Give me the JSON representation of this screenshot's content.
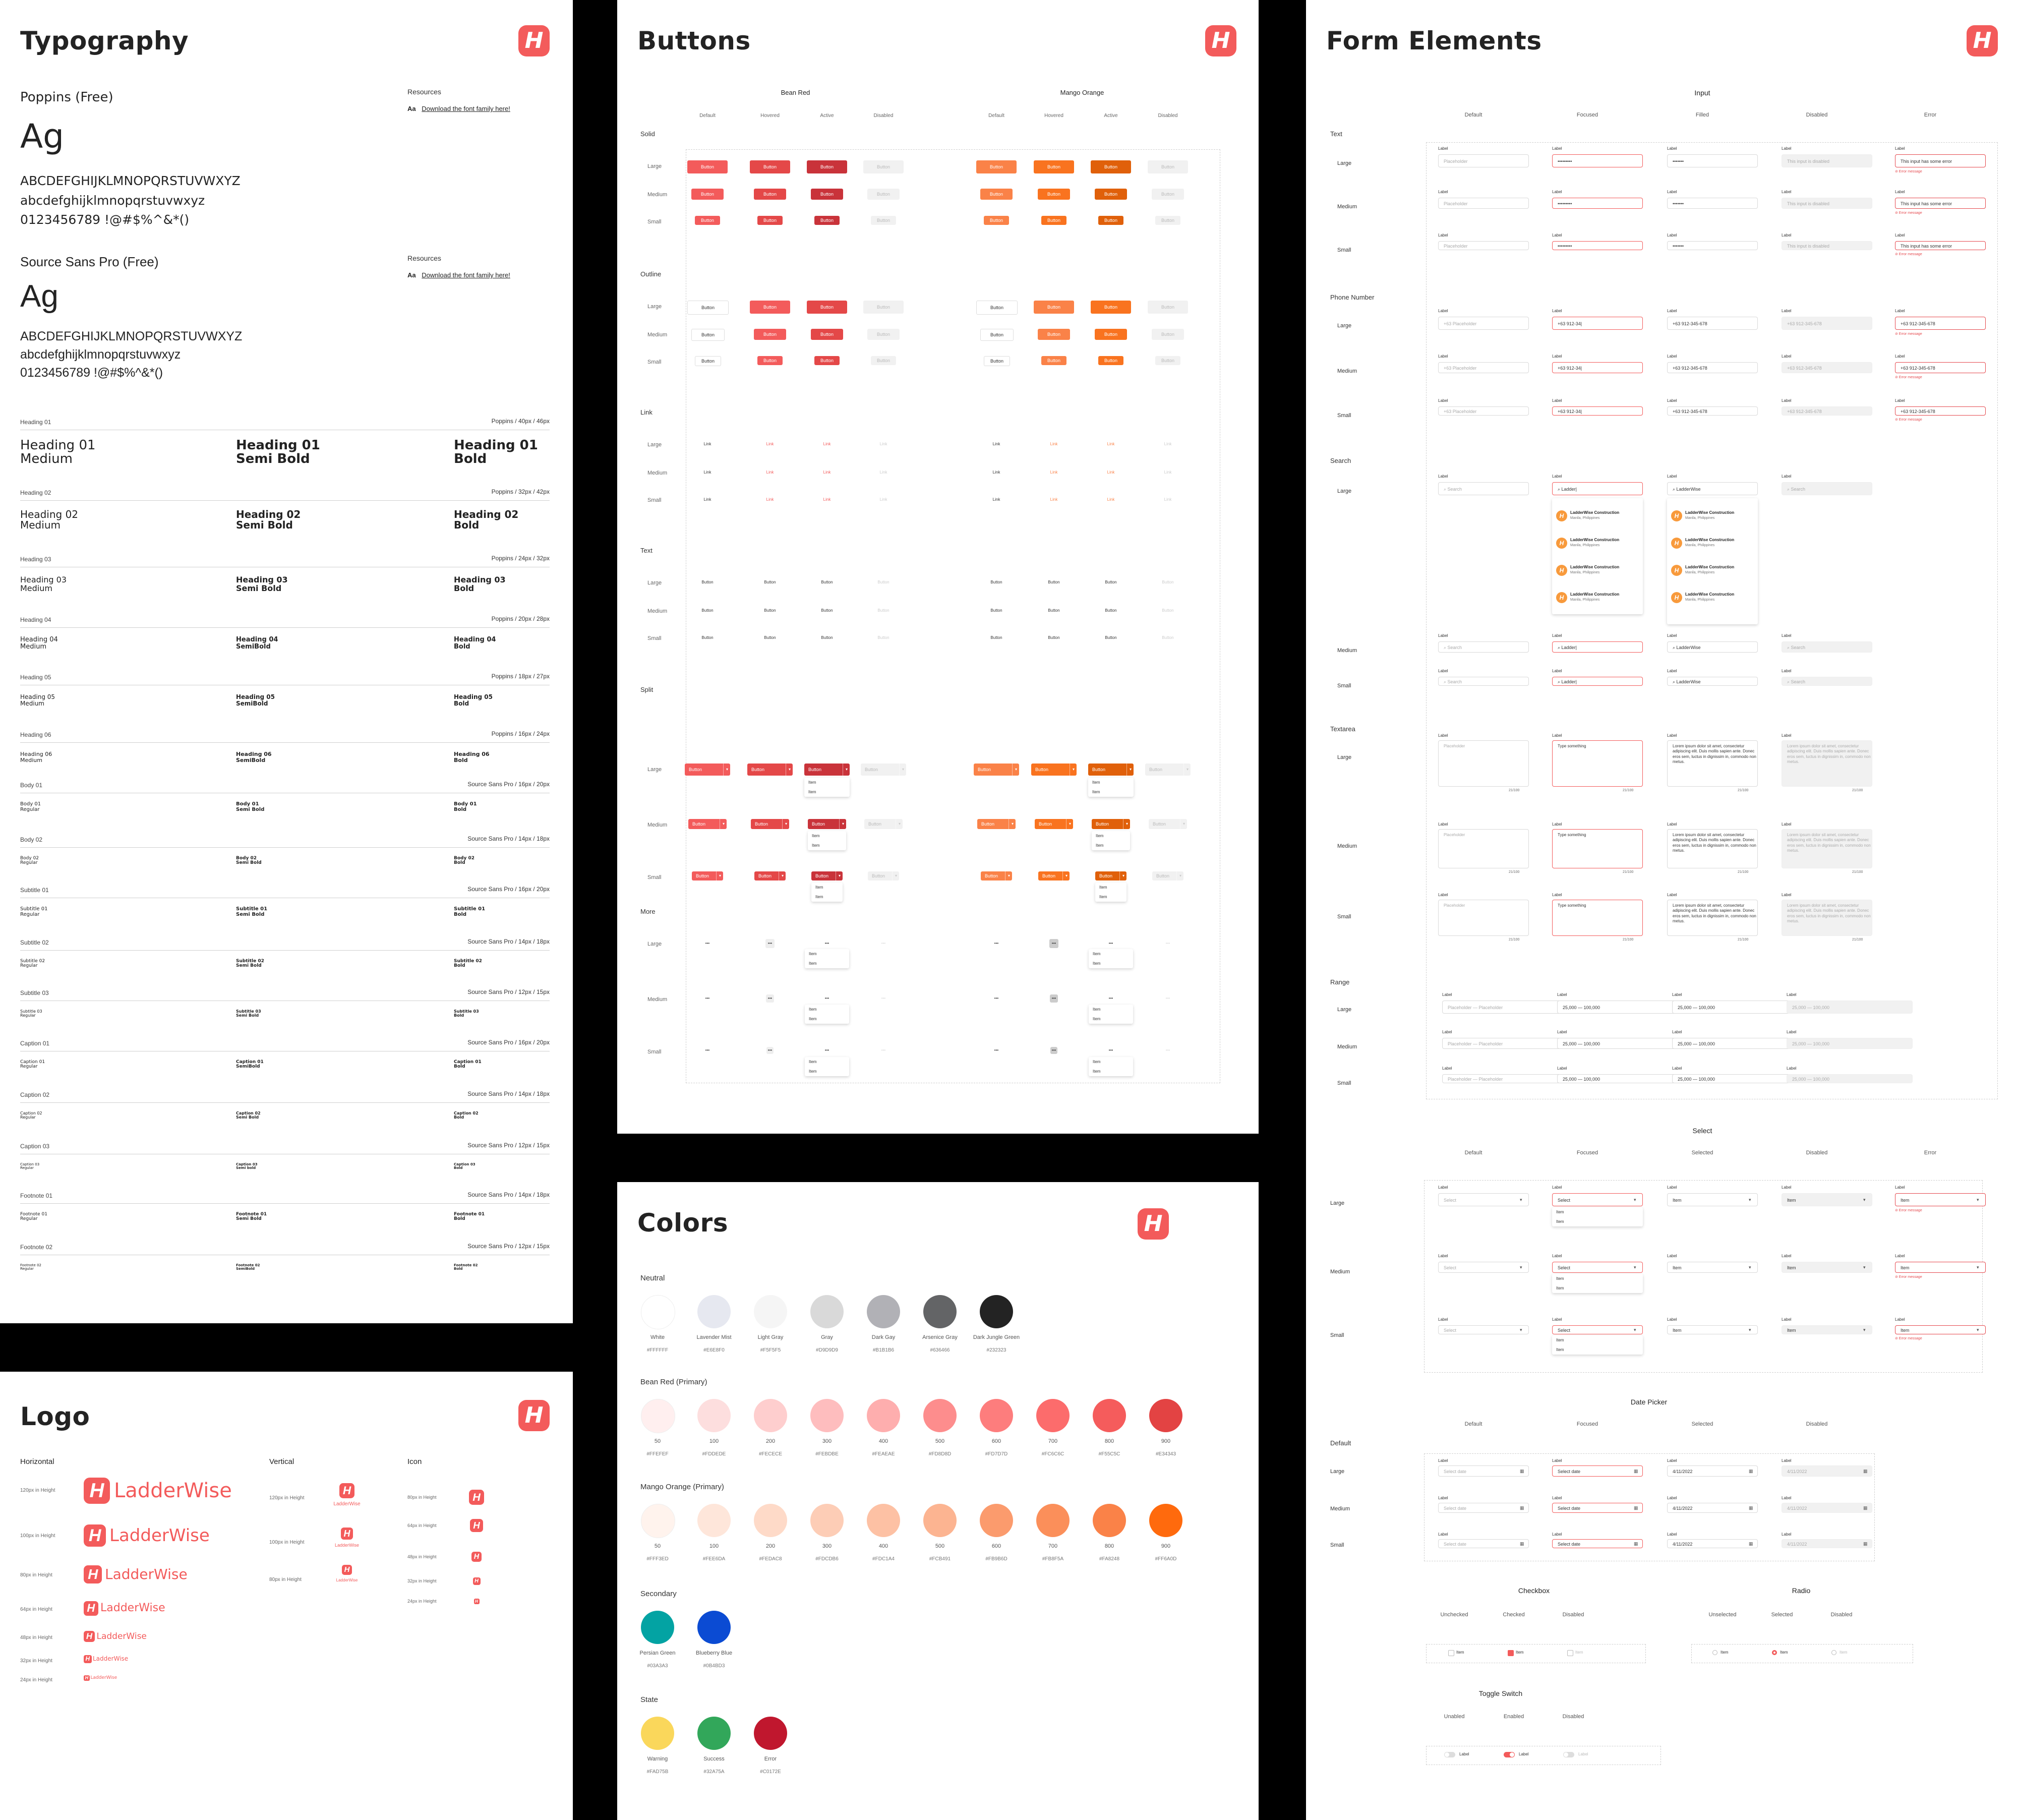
{
  "typography": {
    "title": "Typography",
    "font1": {
      "name": "Poppins (Free)",
      "sample": "Ag",
      "upper": "ABCDEFGHIJKLMNOPQRSTUVWXYZ",
      "lower": "abcdefghijklmnopqrstuvwxyz",
      "digits": "0123456789 !@#$%^&*()"
    },
    "font2": {
      "name": "Source Sans Pro (Free)",
      "sample": "Ag",
      "upper": "ABCDEFGHIJKLMNOPQRSTUVWXYZ",
      "lower": "abcdefghijklmnopqrstuvwxyz",
      "digits": "0123456789 !@#$%^&*()"
    },
    "resources_label": "Resources",
    "res1_link": "Download the font family here!",
    "res2_link": "Download the font family here!",
    "res_icon": "Aa",
    "styles": [
      {
        "name": "Heading 01",
        "spec": "Poppins / 40px / 46px",
        "variants": [
          "Heading 01\nMedium",
          "Heading 01\nSemi Bold",
          "Heading 01\nBold"
        ]
      },
      {
        "name": "Heading 02",
        "spec": "Poppins / 32px / 42px",
        "variants": [
          "Heading 02\nMedium",
          "Heading 02\nSemi Bold",
          "Heading 02\nBold"
        ]
      },
      {
        "name": "Heading 03",
        "spec": "Poppins / 24px / 32px",
        "variants": [
          "Heading 03\nMedium",
          "Heading 03\nSemi Bold",
          "Heading 03\nBold"
        ]
      },
      {
        "name": "Heading 04",
        "spec": "Poppins / 20px / 28px",
        "variants": [
          "Heading 04\nMedium",
          "Heading 04\nSemiBold",
          "Heading 04\nBold"
        ]
      },
      {
        "name": "Heading 05",
        "spec": "Poppins / 18px / 27px",
        "variants": [
          "Heading 05\nMedium",
          "Heading 05\nSemiBold",
          "Heading 05\nBold"
        ]
      },
      {
        "name": "Heading 06",
        "spec": "Poppins / 16px / 24px",
        "variants": [
          "Heading 06\nMedium",
          "Heading 06\nSemiBold",
          "Heading 06\nBold"
        ]
      },
      {
        "name": "Body 01",
        "spec": "Source Sans Pro / 16px / 20px",
        "variants": [
          "Body 01\nRegular",
          "Body 01\nSemi Bold",
          "Body 01\nBold"
        ]
      },
      {
        "name": "Body 02",
        "spec": "Source Sans Pro / 14px / 18px",
        "variants": [
          "Body 02\nRegular",
          "Body 02\nSemi Bold",
          "Body 02\nBold"
        ]
      },
      {
        "name": "Subtitle 01",
        "spec": "Source Sans Pro / 16px / 20px",
        "variants": [
          "Subtitle 01\nRegular",
          "Subtitle 01\nSemi Bold",
          "Subtitle 01\nBold"
        ]
      },
      {
        "name": "Subtitle 02",
        "spec": "Source Sans Pro / 14px / 18px",
        "variants": [
          "Subtitle 02\nRegular",
          "Subtitle 02\nSemi Bold",
          "Subtitle 02\nBold"
        ]
      },
      {
        "name": "Subtitle 03",
        "spec": "Source Sans Pro / 12px / 15px",
        "variants": [
          "Subtitle 03\nRegular",
          "Subtitle 03\nSemi Bold",
          "Subtitle 03\nBold"
        ]
      },
      {
        "name": "Caption 01",
        "spec": "Source Sans Pro / 16px / 20px",
        "variants": [
          "Caption 01\nRegular",
          "Caption 01\nSemiBold",
          "Caption 01\nBold"
        ]
      },
      {
        "name": "Caption 02",
        "spec": "Source Sans Pro / 14px / 18px",
        "variants": [
          "Caption 02\nRegular",
          "Caption 02\nSemi Bold",
          "Caption 02\nBold"
        ]
      },
      {
        "name": "Caption 03",
        "spec": "Source Sans Pro / 12px / 15px",
        "variants": [
          "Caption 03\nRegular",
          "Caption 03\nSemi bold",
          "Caption 03\nBold"
        ]
      },
      {
        "name": "Footnote 01",
        "spec": "Source Sans Pro / 14px / 18px",
        "variants": [
          "Footnote 01\nRegular",
          "Footnote 01\nSemi Bold",
          "Footnote 01\nBold"
        ]
      },
      {
        "name": "Footnote 02",
        "spec": "Source Sans Pro / 12px / 15px",
        "variants": [
          "Footnote 02\nRegular",
          "Footnote 02\nSemiBold",
          "Footnote 02\nBold"
        ]
      }
    ]
  },
  "logo": {
    "title": "Logo",
    "brand": "LadderWise",
    "horizontal_label": "Horizontal",
    "vertical_label": "Vertical",
    "icon_label": "Icon",
    "horizontal_sizes": [
      "120px in Height",
      "100px in Height",
      "80px in Height",
      "64px in Height",
      "48px in Height",
      "32px in Height",
      "24px in Height"
    ],
    "vertical_sizes": [
      "120px in Height",
      "100px in Height",
      "80px in Height"
    ],
    "icon_sizes": [
      "80px in Height",
      "64px in Height",
      "48px in Height",
      "32px in Height",
      "24px in Height"
    ]
  },
  "buttons": {
    "title": "Buttons",
    "palette_names": [
      "Bean Red",
      "Mango Orange"
    ],
    "states": [
      "Default",
      "Hovered",
      "Active",
      "Disabled"
    ],
    "sizes": [
      "Large",
      "Medium",
      "Small"
    ],
    "groups": [
      "Solid",
      "Outline",
      "Link",
      "Text",
      "Split",
      "More"
    ],
    "button_text": "Button",
    "link_text": "Link",
    "item_text": "Item",
    "more_text": "•••"
  },
  "colors": {
    "title": "Colors",
    "groups": [
      {
        "name": "Neutral",
        "swatches": [
          {
            "label": "White",
            "hex": "#FFFFFF"
          },
          {
            "label": "Lavender Mist",
            "hex": "#E6E8F0"
          },
          {
            "label": "Light Gray",
            "hex": "#F5F5F5"
          },
          {
            "label": "Gray",
            "hex": "#D9D9D9"
          },
          {
            "label": "Dark Gay",
            "hex": "#B1B1B6"
          },
          {
            "label": "Arsenice Gray",
            "hex": "#636466"
          },
          {
            "label": "Dark Jungle Green",
            "hex": "#232323"
          }
        ]
      },
      {
        "name": "Bean Red (Primary)",
        "swatches": [
          {
            "label": "50",
            "hex": "#FFEFEF"
          },
          {
            "label": "100",
            "hex": "#FDDEDE"
          },
          {
            "label": "200",
            "hex": "#FECECE"
          },
          {
            "label": "300",
            "hex": "#FEBDBE"
          },
          {
            "label": "400",
            "hex": "#FEAEAE"
          },
          {
            "label": "500",
            "hex": "#FD8D8D"
          },
          {
            "label": "600",
            "hex": "#FD7D7D"
          },
          {
            "label": "700",
            "hex": "#FC6C6C"
          },
          {
            "label": "800",
            "hex": "#F55C5C"
          },
          {
            "label": "900",
            "hex": "#E34343"
          }
        ]
      },
      {
        "name": "Mango Orange (Primary)",
        "swatches": [
          {
            "label": "50",
            "hex": "#FFF3ED"
          },
          {
            "label": "100",
            "hex": "#FEE6DA"
          },
          {
            "label": "200",
            "hex": "#FEDAC8"
          },
          {
            "label": "300",
            "hex": "#FDCDB6"
          },
          {
            "label": "400",
            "hex": "#FDC1A4"
          },
          {
            "label": "500",
            "hex": "#FCB491"
          },
          {
            "label": "600",
            "hex": "#FB9B6D"
          },
          {
            "label": "700",
            "hex": "#FB8F5A"
          },
          {
            "label": "800",
            "hex": "#FA8248"
          },
          {
            "label": "900",
            "hex": "#FF6A0D"
          }
        ]
      },
      {
        "name": "Secondary",
        "swatches": [
          {
            "label": "Persian Green",
            "hex": "#03A3A3"
          },
          {
            "label": "Blueberry Blue",
            "hex": "#0B4BD3"
          }
        ]
      },
      {
        "name": "State",
        "swatches": [
          {
            "label": "Warning",
            "hex": "#FAD75B"
          },
          {
            "label": "Success",
            "hex": "#32A75A"
          },
          {
            "label": "Error",
            "hex": "#C0172E"
          }
        ]
      }
    ]
  },
  "form": {
    "title": "Form Elements",
    "input_title": "Input",
    "input_states": [
      "Default",
      "Focused",
      "Filled",
      "Disabled",
      "Error"
    ],
    "rows": [
      "Text",
      "Phone Number",
      "Search",
      "Textarea",
      "Range"
    ],
    "sizes": [
      "Large",
      "Medium",
      "Small"
    ],
    "label": "Label",
    "placeholder": "Placeholder",
    "disabled_text": "This input is disabled",
    "error_text": "This input has some error",
    "error_msg": "Error message",
    "prefix": "+63",
    "phone": "912-345-678",
    "search_text": "Search",
    "search_focus": "Ladder|",
    "search_filled": "LadderWise",
    "result_name": "LadderWise Construction",
    "result_loc": "Manila, Philippines",
    "type_text": "Type something",
    "lorem": "Lorem ipsum dolor sit amet, consectetur adipiscing elit. Duis mollis sapien ante. Donec eros sem, luctus in dignissim in, commodo non metus.",
    "counter": "21/100",
    "range_a": "25,000",
    "range_b": "100,000",
    "select_title": "Select",
    "select_states": [
      "Default",
      "Focused",
      "Selected",
      "Disabled",
      "Error"
    ],
    "select_placeholder": "Select",
    "item": "Item",
    "datepicker_title": "Date Picker",
    "date_states": [
      "Default",
      "Focused",
      "Selected",
      "Disabled"
    ],
    "date_group": "Default",
    "date_placeholder": "Select date",
    "date_value": "4/11/2022",
    "checkbox_title": "Checkbox",
    "checkbox_states": [
      "Unchecked",
      "Checked",
      "Disabled"
    ],
    "radio_title": "Radio",
    "radio_states": [
      "Unselected",
      "Selected",
      "Disabled"
    ],
    "toggle_title": "Toggle Switch",
    "toggle_states": [
      "Unabled",
      "Enabled",
      "Disabled"
    ],
    "item_short": "Item",
    "toggle_label": "Label"
  },
  "brand_colors": {
    "red": "#F35B5B",
    "red_hover": "#E44848",
    "red_active": "#C9333A",
    "orange": "#FA8248",
    "orange_hover": "#F9731F",
    "orange_active": "#E0600A"
  }
}
